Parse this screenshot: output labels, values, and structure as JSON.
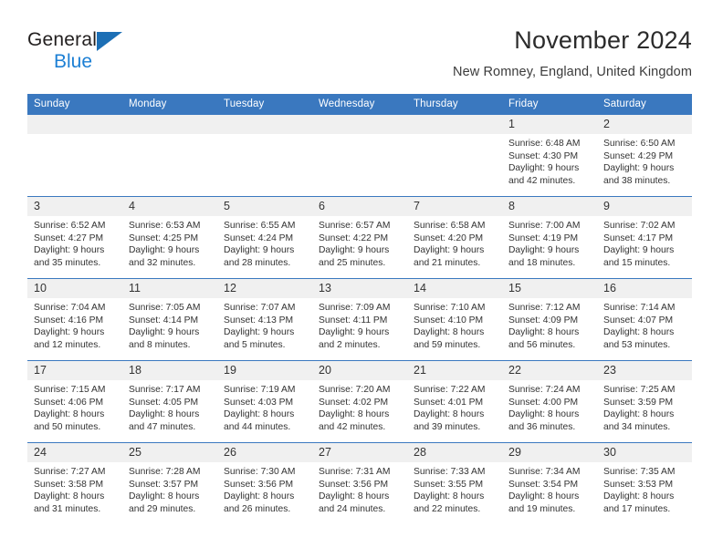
{
  "brand": {
    "name_top": "General",
    "name_bottom": "Blue",
    "triangle_color": "#1c6fb5",
    "blue_text_color": "#1c7fd4"
  },
  "header": {
    "title": "November 2024",
    "subtitle": "New Romney, England, United Kingdom"
  },
  "theme": {
    "header_row_bg": "#3a78bf",
    "daynum_bg": "#f0f0f0",
    "text_color": "#333333"
  },
  "weekday_headers": [
    "Sunday",
    "Monday",
    "Tuesday",
    "Wednesday",
    "Thursday",
    "Friday",
    "Saturday"
  ],
  "labels": {
    "sunrise_prefix": "Sunrise:",
    "sunset_prefix": "Sunset:",
    "daylight_prefix": "Daylight:"
  },
  "weeks": [
    [
      {
        "day": "",
        "blank": true,
        "sunrise": "",
        "sunset": "",
        "daylight_line1": "",
        "daylight_line2": ""
      },
      {
        "day": "",
        "blank": true,
        "sunrise": "",
        "sunset": "",
        "daylight_line1": "",
        "daylight_line2": ""
      },
      {
        "day": "",
        "blank": true,
        "sunrise": "",
        "sunset": "",
        "daylight_line1": "",
        "daylight_line2": ""
      },
      {
        "day": "",
        "blank": true,
        "sunrise": "",
        "sunset": "",
        "daylight_line1": "",
        "daylight_line2": ""
      },
      {
        "day": "",
        "blank": true,
        "sunrise": "",
        "sunset": "",
        "daylight_line1": "",
        "daylight_line2": ""
      },
      {
        "day": "1",
        "blank": false,
        "sunrise": "Sunrise: 6:48 AM",
        "sunset": "Sunset: 4:30 PM",
        "daylight_line1": "Daylight: 9 hours",
        "daylight_line2": "and 42 minutes."
      },
      {
        "day": "2",
        "blank": false,
        "sunrise": "Sunrise: 6:50 AM",
        "sunset": "Sunset: 4:29 PM",
        "daylight_line1": "Daylight: 9 hours",
        "daylight_line2": "and 38 minutes."
      }
    ],
    [
      {
        "day": "3",
        "blank": false,
        "sunrise": "Sunrise: 6:52 AM",
        "sunset": "Sunset: 4:27 PM",
        "daylight_line1": "Daylight: 9 hours",
        "daylight_line2": "and 35 minutes."
      },
      {
        "day": "4",
        "blank": false,
        "sunrise": "Sunrise: 6:53 AM",
        "sunset": "Sunset: 4:25 PM",
        "daylight_line1": "Daylight: 9 hours",
        "daylight_line2": "and 32 minutes."
      },
      {
        "day": "5",
        "blank": false,
        "sunrise": "Sunrise: 6:55 AM",
        "sunset": "Sunset: 4:24 PM",
        "daylight_line1": "Daylight: 9 hours",
        "daylight_line2": "and 28 minutes."
      },
      {
        "day": "6",
        "blank": false,
        "sunrise": "Sunrise: 6:57 AM",
        "sunset": "Sunset: 4:22 PM",
        "daylight_line1": "Daylight: 9 hours",
        "daylight_line2": "and 25 minutes."
      },
      {
        "day": "7",
        "blank": false,
        "sunrise": "Sunrise: 6:58 AM",
        "sunset": "Sunset: 4:20 PM",
        "daylight_line1": "Daylight: 9 hours",
        "daylight_line2": "and 21 minutes."
      },
      {
        "day": "8",
        "blank": false,
        "sunrise": "Sunrise: 7:00 AM",
        "sunset": "Sunset: 4:19 PM",
        "daylight_line1": "Daylight: 9 hours",
        "daylight_line2": "and 18 minutes."
      },
      {
        "day": "9",
        "blank": false,
        "sunrise": "Sunrise: 7:02 AM",
        "sunset": "Sunset: 4:17 PM",
        "daylight_line1": "Daylight: 9 hours",
        "daylight_line2": "and 15 minutes."
      }
    ],
    [
      {
        "day": "10",
        "blank": false,
        "sunrise": "Sunrise: 7:04 AM",
        "sunset": "Sunset: 4:16 PM",
        "daylight_line1": "Daylight: 9 hours",
        "daylight_line2": "and 12 minutes."
      },
      {
        "day": "11",
        "blank": false,
        "sunrise": "Sunrise: 7:05 AM",
        "sunset": "Sunset: 4:14 PM",
        "daylight_line1": "Daylight: 9 hours",
        "daylight_line2": "and 8 minutes."
      },
      {
        "day": "12",
        "blank": false,
        "sunrise": "Sunrise: 7:07 AM",
        "sunset": "Sunset: 4:13 PM",
        "daylight_line1": "Daylight: 9 hours",
        "daylight_line2": "and 5 minutes."
      },
      {
        "day": "13",
        "blank": false,
        "sunrise": "Sunrise: 7:09 AM",
        "sunset": "Sunset: 4:11 PM",
        "daylight_line1": "Daylight: 9 hours",
        "daylight_line2": "and 2 minutes."
      },
      {
        "day": "14",
        "blank": false,
        "sunrise": "Sunrise: 7:10 AM",
        "sunset": "Sunset: 4:10 PM",
        "daylight_line1": "Daylight: 8 hours",
        "daylight_line2": "and 59 minutes."
      },
      {
        "day": "15",
        "blank": false,
        "sunrise": "Sunrise: 7:12 AM",
        "sunset": "Sunset: 4:09 PM",
        "daylight_line1": "Daylight: 8 hours",
        "daylight_line2": "and 56 minutes."
      },
      {
        "day": "16",
        "blank": false,
        "sunrise": "Sunrise: 7:14 AM",
        "sunset": "Sunset: 4:07 PM",
        "daylight_line1": "Daylight: 8 hours",
        "daylight_line2": "and 53 minutes."
      }
    ],
    [
      {
        "day": "17",
        "blank": false,
        "sunrise": "Sunrise: 7:15 AM",
        "sunset": "Sunset: 4:06 PM",
        "daylight_line1": "Daylight: 8 hours",
        "daylight_line2": "and 50 minutes."
      },
      {
        "day": "18",
        "blank": false,
        "sunrise": "Sunrise: 7:17 AM",
        "sunset": "Sunset: 4:05 PM",
        "daylight_line1": "Daylight: 8 hours",
        "daylight_line2": "and 47 minutes."
      },
      {
        "day": "19",
        "blank": false,
        "sunrise": "Sunrise: 7:19 AM",
        "sunset": "Sunset: 4:03 PM",
        "daylight_line1": "Daylight: 8 hours",
        "daylight_line2": "and 44 minutes."
      },
      {
        "day": "20",
        "blank": false,
        "sunrise": "Sunrise: 7:20 AM",
        "sunset": "Sunset: 4:02 PM",
        "daylight_line1": "Daylight: 8 hours",
        "daylight_line2": "and 42 minutes."
      },
      {
        "day": "21",
        "blank": false,
        "sunrise": "Sunrise: 7:22 AM",
        "sunset": "Sunset: 4:01 PM",
        "daylight_line1": "Daylight: 8 hours",
        "daylight_line2": "and 39 minutes."
      },
      {
        "day": "22",
        "blank": false,
        "sunrise": "Sunrise: 7:24 AM",
        "sunset": "Sunset: 4:00 PM",
        "daylight_line1": "Daylight: 8 hours",
        "daylight_line2": "and 36 minutes."
      },
      {
        "day": "23",
        "blank": false,
        "sunrise": "Sunrise: 7:25 AM",
        "sunset": "Sunset: 3:59 PM",
        "daylight_line1": "Daylight: 8 hours",
        "daylight_line2": "and 34 minutes."
      }
    ],
    [
      {
        "day": "24",
        "blank": false,
        "sunrise": "Sunrise: 7:27 AM",
        "sunset": "Sunset: 3:58 PM",
        "daylight_line1": "Daylight: 8 hours",
        "daylight_line2": "and 31 minutes."
      },
      {
        "day": "25",
        "blank": false,
        "sunrise": "Sunrise: 7:28 AM",
        "sunset": "Sunset: 3:57 PM",
        "daylight_line1": "Daylight: 8 hours",
        "daylight_line2": "and 29 minutes."
      },
      {
        "day": "26",
        "blank": false,
        "sunrise": "Sunrise: 7:30 AM",
        "sunset": "Sunset: 3:56 PM",
        "daylight_line1": "Daylight: 8 hours",
        "daylight_line2": "and 26 minutes."
      },
      {
        "day": "27",
        "blank": false,
        "sunrise": "Sunrise: 7:31 AM",
        "sunset": "Sunset: 3:56 PM",
        "daylight_line1": "Daylight: 8 hours",
        "daylight_line2": "and 24 minutes."
      },
      {
        "day": "28",
        "blank": false,
        "sunrise": "Sunrise: 7:33 AM",
        "sunset": "Sunset: 3:55 PM",
        "daylight_line1": "Daylight: 8 hours",
        "daylight_line2": "and 22 minutes."
      },
      {
        "day": "29",
        "blank": false,
        "sunrise": "Sunrise: 7:34 AM",
        "sunset": "Sunset: 3:54 PM",
        "daylight_line1": "Daylight: 8 hours",
        "daylight_line2": "and 19 minutes."
      },
      {
        "day": "30",
        "blank": false,
        "sunrise": "Sunrise: 7:35 AM",
        "sunset": "Sunset: 3:53 PM",
        "daylight_line1": "Daylight: 8 hours",
        "daylight_line2": "and 17 minutes."
      }
    ]
  ]
}
